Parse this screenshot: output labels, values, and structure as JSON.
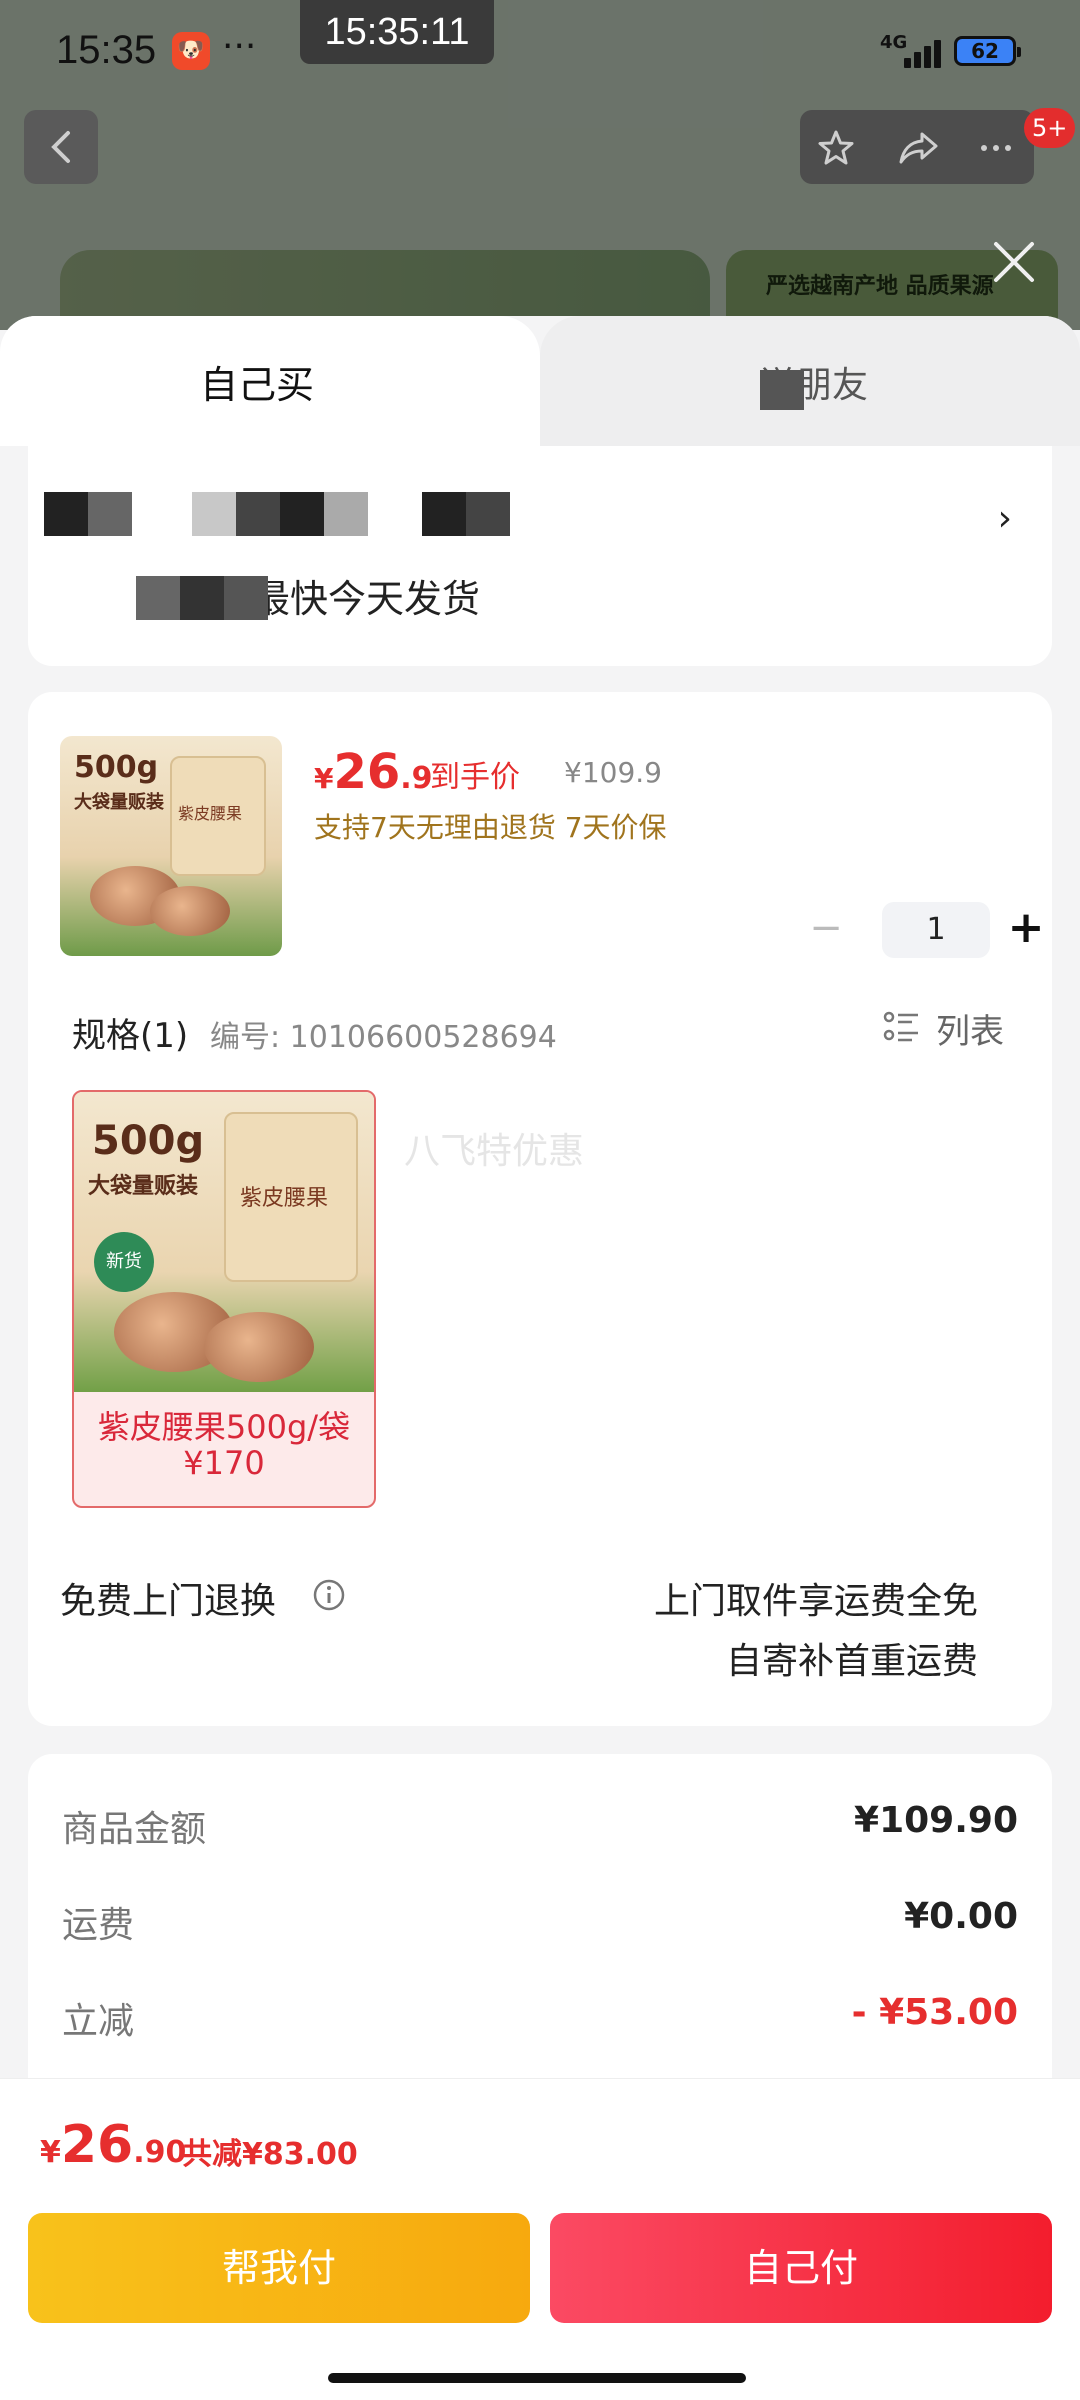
{
  "status_bar": {
    "time": "15:35",
    "app_badge": "🐶",
    "more": "···",
    "clock": "15:35:11",
    "network": "4G",
    "battery": "62"
  },
  "background": {
    "banner_right_text": "严选越南产地 品质果源",
    "notif_badge": "5+"
  },
  "tabs": {
    "active": "自己买",
    "inactive": "送朋友"
  },
  "address": {
    "ship_text": "最快今天发货"
  },
  "product": {
    "price_yen": "¥",
    "price_int": "26",
    "price_dec": ".9",
    "price_label": "到手价",
    "original_price": "¥109.9",
    "guarantee": "支持7天无理由退货  7天价保",
    "quantity": "1",
    "minus": "−",
    "plus": "+",
    "thumb_weight": "500g",
    "thumb_title": "大袋量贩装",
    "thumb_pack": "紫皮腰果"
  },
  "spec": {
    "label": "规格(1)",
    "code": "编号: 10106600528694",
    "view_toggle": "列表",
    "watermark": "八飞特优惠",
    "sku": {
      "name": "紫皮腰果500g/袋",
      "price": "¥170",
      "weight": "500g",
      "title": "大袋量贩装",
      "pack": "紫皮腰果",
      "tag": "新货"
    }
  },
  "returns": {
    "label": "免费上门退换",
    "line1": "上门取件享运费全免",
    "line2": "自寄补首重运费"
  },
  "summary": {
    "rows": [
      {
        "k": "商品金额",
        "v": "¥109.90"
      },
      {
        "k": "运费",
        "v": "¥0.00"
      },
      {
        "k": "立减",
        "v": "- ¥53.00"
      }
    ]
  },
  "bottom": {
    "total_yen": "¥",
    "total_int": "26",
    "total_dec": ".90",
    "saved": "共减¥83.00",
    "help_pay": "帮我付",
    "self_pay": "自己付"
  },
  "colors": {
    "accent_red": "#e62e2e",
    "help_btn": "#f8b715",
    "self_btn": "#f7313e",
    "guarantee": "#a0741d"
  }
}
